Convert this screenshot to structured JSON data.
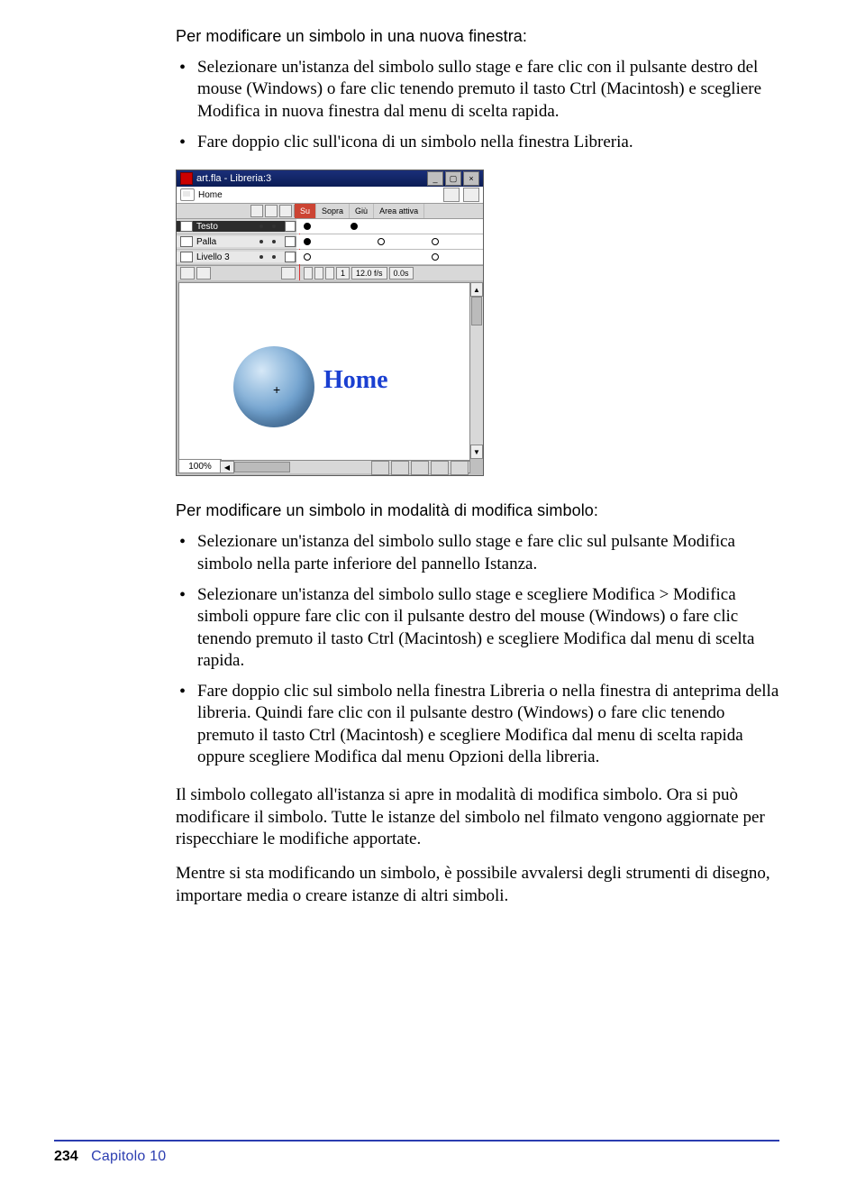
{
  "section1": {
    "heading": "Per modificare un simbolo in una nuova finestra:",
    "bullets": [
      "Selezionare un'istanza del simbolo sullo stage e fare clic con il pulsante destro del mouse (Windows) o fare clic tenendo premuto il tasto Ctrl (Macintosh) e scegliere Modifica in nuova finestra dal menu di scelta rapida.",
      "Fare doppio clic sull'icona di un simbolo nella finestra Libreria."
    ]
  },
  "screenshot": {
    "window_title": "art.fla - Libreria:3",
    "breadcrumb": "Home",
    "timeline_header": {
      "su": "Su",
      "sopra": "Sopra",
      "giu": "Giù",
      "area": "Area attiva"
    },
    "layers": [
      {
        "name": "Testo"
      },
      {
        "name": "Palla"
      },
      {
        "name": "Livello 3"
      }
    ],
    "footer": {
      "frame": "1",
      "fps": "12.0 f/s",
      "time": "0.0s"
    },
    "zoom": "100%",
    "home_label": "Home"
  },
  "section2": {
    "heading": "Per modificare un simbolo in modalità di modifica simbolo:",
    "bullets": [
      "Selezionare un'istanza del simbolo sullo stage e fare clic sul pulsante Modifica simbolo nella parte inferiore del pannello Istanza.",
      "Selezionare un'istanza del simbolo sullo stage e scegliere Modifica > Modifica simboli oppure fare clic con il pulsante destro del mouse (Windows) o fare clic tenendo premuto il tasto Ctrl (Macintosh) e scegliere Modifica dal menu di scelta rapida.",
      "Fare doppio clic sul simbolo nella finestra Libreria o nella finestra di anteprima della libreria. Quindi fare clic con il pulsante destro (Windows) o fare clic tenendo premuto il tasto Ctrl (Macintosh) e scegliere Modifica dal menu di scelta rapida oppure scegliere Modifica dal menu Opzioni della libreria."
    ],
    "paras": [
      "Il simbolo collegato all'istanza si apre in modalità di modifica simbolo. Ora si può modificare il simbolo. Tutte le istanze del simbolo nel filmato vengono aggiornate per rispecchiare le modifiche apportate.",
      "Mentre si sta modificando un simbolo, è possibile avvalersi degli strumenti di disegno, importare media o creare istanze di altri simboli."
    ]
  },
  "footer": {
    "page": "234",
    "chapter": "Capitolo 10"
  }
}
